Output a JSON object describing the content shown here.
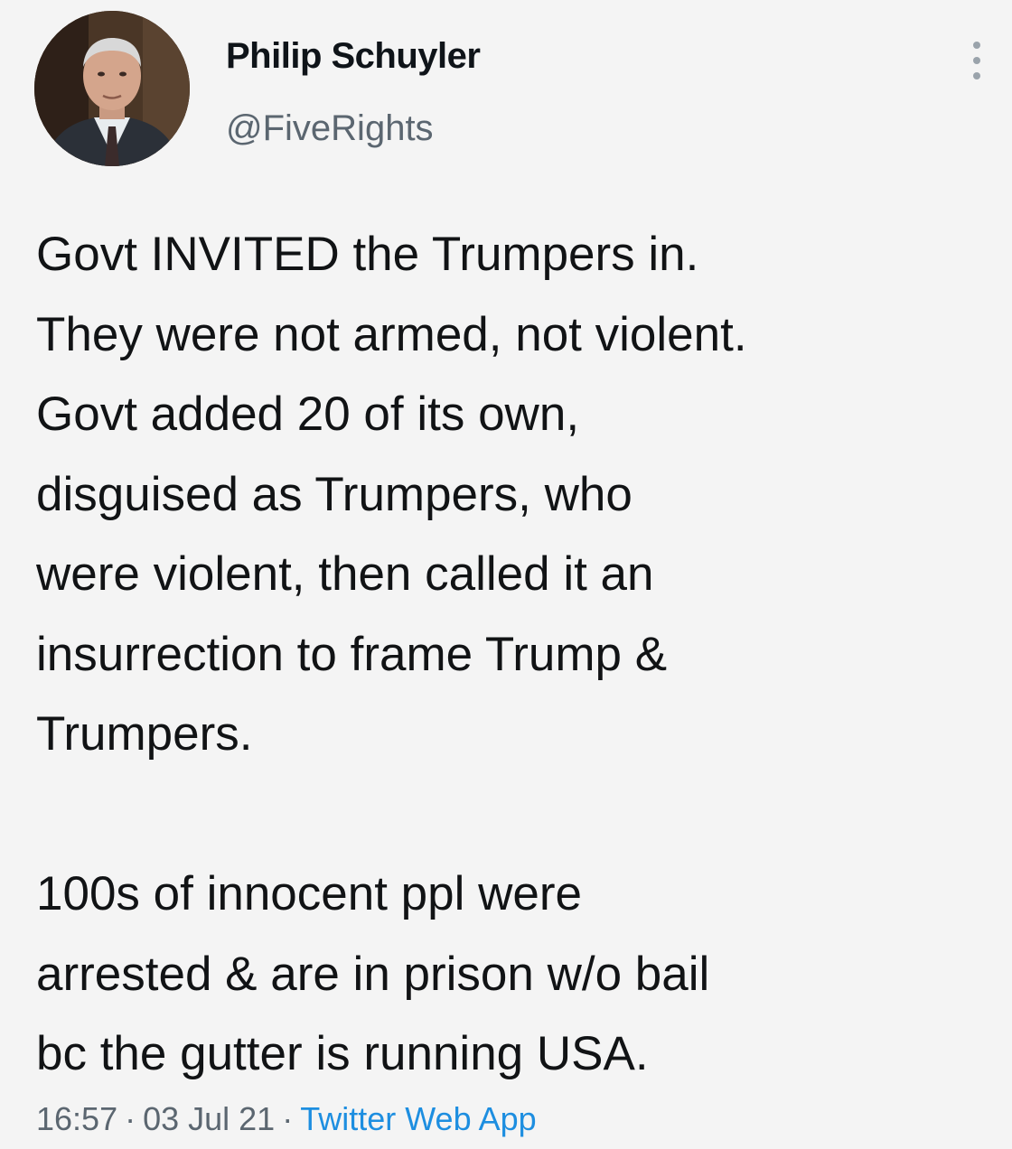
{
  "author": {
    "display_name": "Philip Schuyler",
    "handle": "@FiveRights",
    "avatar_icon": "profile-photo"
  },
  "menu_icon": "more-vertical-icon",
  "tweet": {
    "lines": [
      "Govt INVITED the Trumpers in.",
      "They were not armed, not violent.",
      "Govt added 20 of its own,",
      "disguised as Trumpers, who",
      "were violent, then called it an",
      "insurrection to frame Trump &",
      "Trumpers.",
      "",
      "100s of innocent ppl were",
      "arrested & are in prison w/o bail",
      "bc the gutter is running USA."
    ]
  },
  "meta": {
    "time": "16:57",
    "separator": "·",
    "date": "03 Jul 21",
    "source": "Twitter Web App"
  },
  "colors": {
    "background": "#f4f4f4",
    "text": "#111315",
    "secondary": "#5b6670",
    "link": "#1d8ee0"
  }
}
